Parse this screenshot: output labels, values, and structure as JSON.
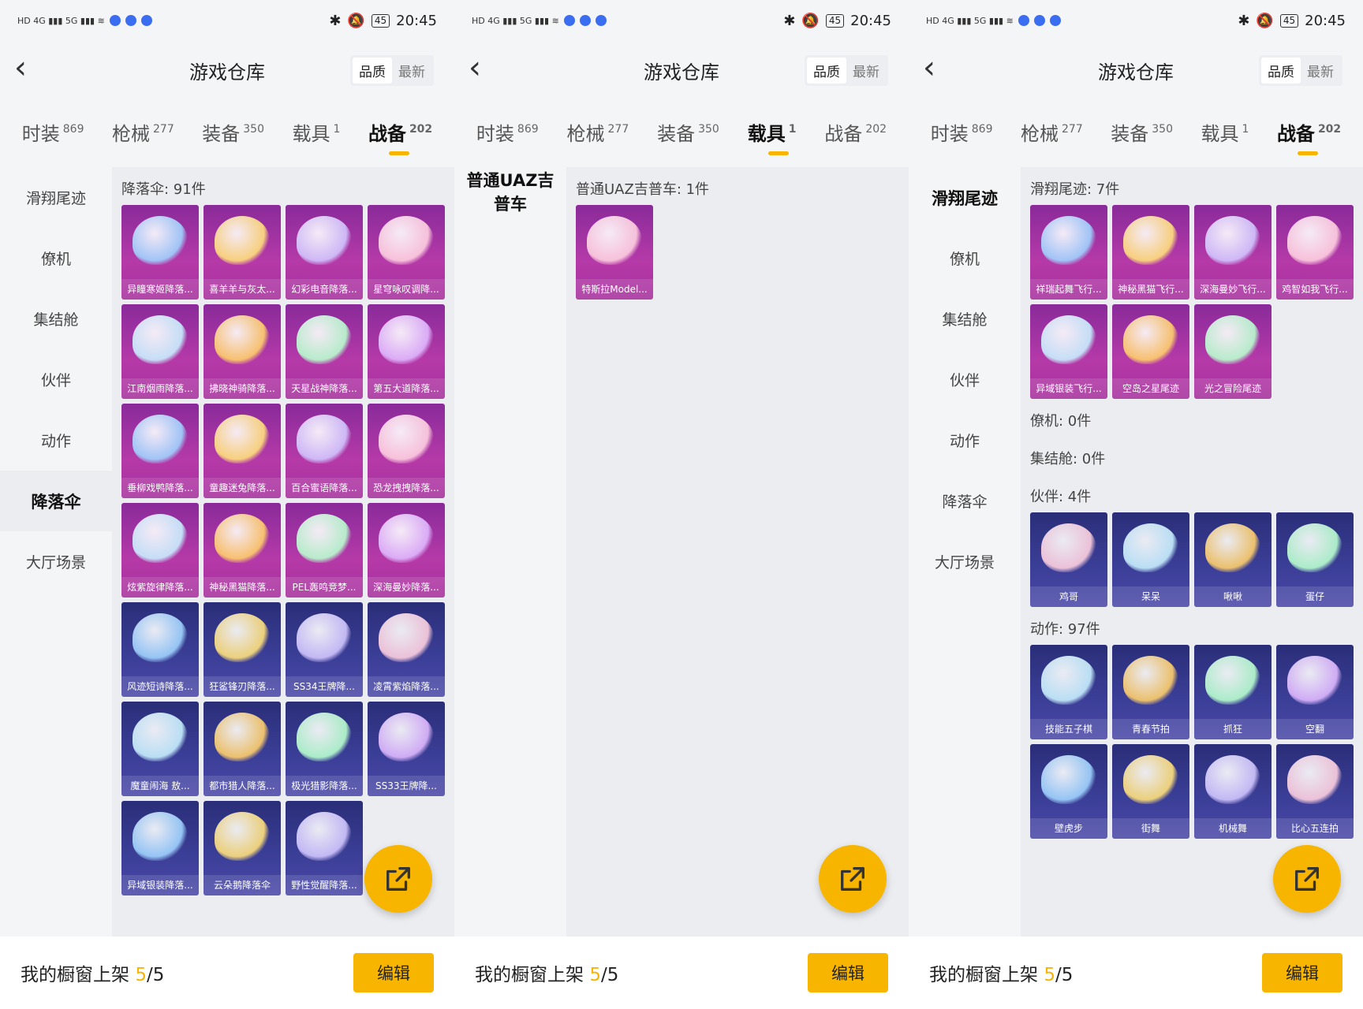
{
  "status": {
    "time": "20:45",
    "battery": "45"
  },
  "header": {
    "title": "游戏仓库",
    "sort": [
      "品质",
      "最新"
    ],
    "back_icon": "‹"
  },
  "tabs": [
    {
      "label": "时装",
      "count": "869"
    },
    {
      "label": "枪械",
      "count": "277"
    },
    {
      "label": "装备",
      "count": "350"
    },
    {
      "label": "载具",
      "count": "1"
    },
    {
      "label": "战备",
      "count": "202"
    }
  ],
  "sidebar": [
    "滑翔尾迹",
    "僚机",
    "集结舱",
    "伙伴",
    "动作",
    "降落伞",
    "大厅场景"
  ],
  "panel1": {
    "section": "降落伞: 91件",
    "items": [
      "异瞳寒姬降落...",
      "喜羊羊与灰太...",
      "幻彩电音降落...",
      "星穹咏叹调降...",
      "江南烟雨降落...",
      "拂晓神骑降落...",
      "天星战神降落...",
      "第五大道降落...",
      "垂柳戏鸭降落...",
      "童趣迷兔降落...",
      "百合蜜语降落...",
      "恐龙拽拽降落...",
      "炫紫旋律降落...",
      "神秘黑猫降落...",
      "PEL轰鸣竞梦...",
      "深海曼妙降落...",
      "风迹短诗降落...",
      "狂鲨锋刃降落...",
      "SS34王牌降...",
      "凌霄紫焰降落...",
      "魔童闹海 敖...",
      "都市猎人降落...",
      "极光猎影降落...",
      "SS33王牌降...",
      "异域银装降落...",
      "云朵鹅降落伞",
      "野性觉醒降落..."
    ]
  },
  "panel2": {
    "category": "普通UAZ吉普车",
    "section": "普通UAZ吉普车: 1件",
    "items": [
      "特斯拉Model..."
    ]
  },
  "panel3": {
    "sections": [
      {
        "title": "滑翔尾迹: 7件",
        "items": [
          "祥瑞起舞飞行...",
          "神秘黑猫飞行...",
          "深海曼妙飞行...",
          "鸡智如我飞行...",
          "异域银装飞行...",
          "空岛之星尾迹",
          "光之冒险尾迹"
        ]
      },
      {
        "title": "僚机: 0件",
        "items": []
      },
      {
        "title": "集结舱: 0件",
        "items": []
      },
      {
        "title": "伙伴: 4件",
        "items": [
          "鸡哥",
          "呆呆",
          "啾啾",
          "蛋仔"
        ]
      },
      {
        "title": "动作: 97件",
        "items": [
          "技能五子棋",
          "青春节拍",
          "抓狂",
          "空翻",
          "壁虎步",
          "街舞",
          "机械舞",
          "比心五连拍"
        ]
      }
    ]
  },
  "bottom": {
    "label": "我的橱窗上架 ",
    "count": "5",
    "total": "/5",
    "edit": "编辑"
  },
  "colors": {
    "accent": "#f7b500",
    "card_pink": "#a62f9d",
    "card_purple": "#3c3f98"
  }
}
